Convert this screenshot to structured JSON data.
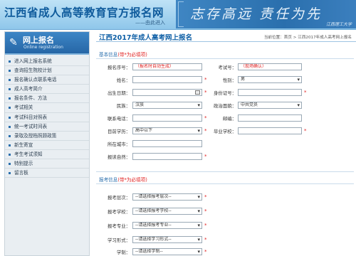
{
  "header": {
    "title": "江西省成人高等教育官方报名网",
    "subtitle": "——由此进入",
    "banner_slogan": "志存高远  责任为先",
    "banner_school": "江西理工大学"
  },
  "sidebar": {
    "title": "网上报名",
    "subtitle": "Online registration",
    "items": [
      {
        "label": "进入网上报名系统"
      },
      {
        "label": "查询招生院校计划"
      },
      {
        "label": "报名确认点联系电话"
      },
      {
        "label": "成人高考简介"
      },
      {
        "label": "报名条件、方法"
      },
      {
        "label": "考试相关"
      },
      {
        "label": "考试科目对照表"
      },
      {
        "label": "统一考试时间表"
      },
      {
        "label": "录取及授档照顾政策"
      },
      {
        "label": "新生寄宣"
      },
      {
        "label": "考生考试须知"
      },
      {
        "label": "特别提示"
      },
      {
        "label": "留言板"
      }
    ]
  },
  "main": {
    "title": "江西2017年成人高考网上报名",
    "breadcrumb": "当前位置：首页 > 江西2017年成人高考网上报名",
    "basic": {
      "label": "基本信息",
      "note": "(带*为必填项)"
    },
    "exam": {
      "label": "报考信息",
      "note": "(带*为必填项)"
    },
    "fields": {
      "reg_no": {
        "label": "报名序号：",
        "value": "（报名时自动生成）"
      },
      "exam_no": {
        "label": "考试号：",
        "value": "（现场确认）"
      },
      "name": {
        "label": "姓名：",
        "value": ""
      },
      "gender": {
        "label": "性别：",
        "value": "男"
      },
      "birthday": {
        "label": "出生日期：",
        "value": ""
      },
      "id_no": {
        "label": "身份证号：",
        "value": ""
      },
      "ethnicity": {
        "label": "民族：",
        "value": "汉族"
      },
      "politics": {
        "label": "政治面貌：",
        "value": "中共党员"
      },
      "phone": {
        "label": "联系电话：",
        "value": ""
      },
      "postcode": {
        "label": "邮编：",
        "value": ""
      },
      "education": {
        "label": "目前学历：",
        "value": "高中以下"
      },
      "graduated_school": {
        "label": "毕业学校：",
        "value": ""
      },
      "city": {
        "label": "所在城市：",
        "value": ""
      },
      "address": {
        "label": "报读自然：",
        "value": ""
      },
      "level": {
        "label": "报考层次：",
        "value": "--请选择报考层次--"
      },
      "school": {
        "label": "报考学校：",
        "value": "--请选择报考学校--"
      },
      "major": {
        "label": "报考专业：",
        "value": "--请选择报考专业--"
      },
      "study_mode": {
        "label": "学习形式：",
        "value": "--请选择学习形式--"
      },
      "duration": {
        "label": "学制：",
        "value": "--请选择学制--"
      }
    }
  },
  "colors": {
    "accent": "#0d5ea5",
    "required": "#e02020",
    "sidebar_head": "#2666a6"
  }
}
